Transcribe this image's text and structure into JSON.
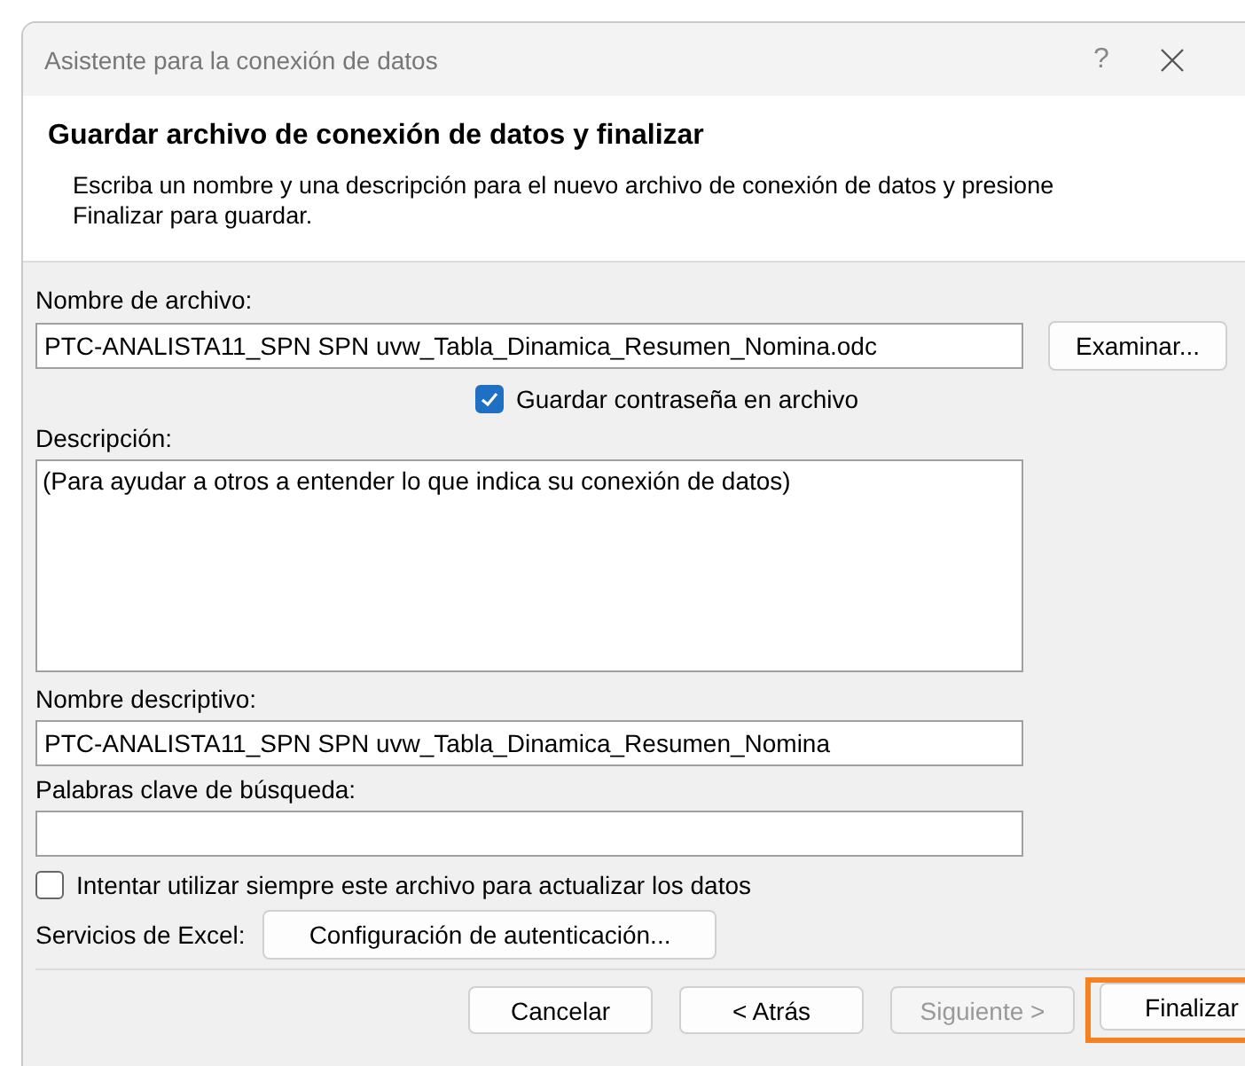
{
  "window": {
    "title": "Asistente para la conexión de datos",
    "help": "?"
  },
  "header": {
    "title": "Guardar archivo de conexión de datos y finalizar",
    "description": "Escriba un nombre y una descripción para el nuevo archivo de conexión de datos y presione Finalizar para guardar."
  },
  "file_name": {
    "label": "Nombre de archivo:",
    "value": "PTC-ANALISTA11_SPN SPN uvw_Tabla_Dinamica_Resumen_Nomina.odc",
    "browse_button": "Examinar..."
  },
  "save_password": {
    "label": "Guardar contraseña en archivo",
    "checked": true
  },
  "description": {
    "label": "Descripción:",
    "placeholder": "(Para ayudar a otros a entender lo que indica su conexión de datos)"
  },
  "friendly_name": {
    "label": "Nombre descriptivo:",
    "value": "PTC-ANALISTA11_SPN SPN uvw_Tabla_Dinamica_Resumen_Nomina"
  },
  "keywords": {
    "label": "Palabras clave de búsqueda:"
  },
  "always_use": {
    "label": "Intentar utilizar siempre este archivo para actualizar los datos",
    "checked": false
  },
  "excel_services": {
    "label": "Servicios de Excel:",
    "button": "Configuración de autenticación..."
  },
  "buttons": [
    {
      "label": "Cancelar",
      "disabled": false,
      "highlighted": false
    },
    {
      "label": "< Atrás",
      "disabled": false,
      "highlighted": false
    },
    {
      "label": "Siguiente >",
      "disabled": true,
      "highlighted": false
    },
    {
      "label": "Finalizar",
      "disabled": false,
      "highlighted": true
    }
  ]
}
